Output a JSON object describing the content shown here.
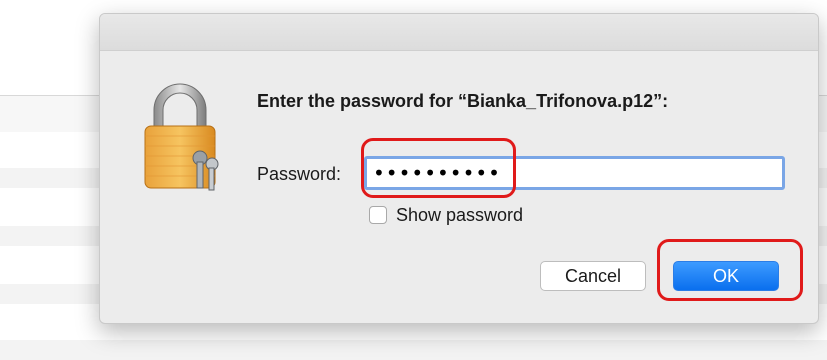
{
  "dialog": {
    "heading": "Enter the password for “Bianka_Trifonova.p12”:",
    "password_label": "Password:",
    "password_value": "••••••••••",
    "show_password_label": "Show password",
    "show_password_checked": false,
    "cancel_label": "Cancel",
    "ok_label": "OK"
  },
  "icons": {
    "dialog_icon": "lock-with-keys-icon"
  },
  "colors": {
    "ok_button": "#1a7ff5",
    "focus_ring": "#7aa6e6",
    "annotation": "#e01a1a"
  }
}
